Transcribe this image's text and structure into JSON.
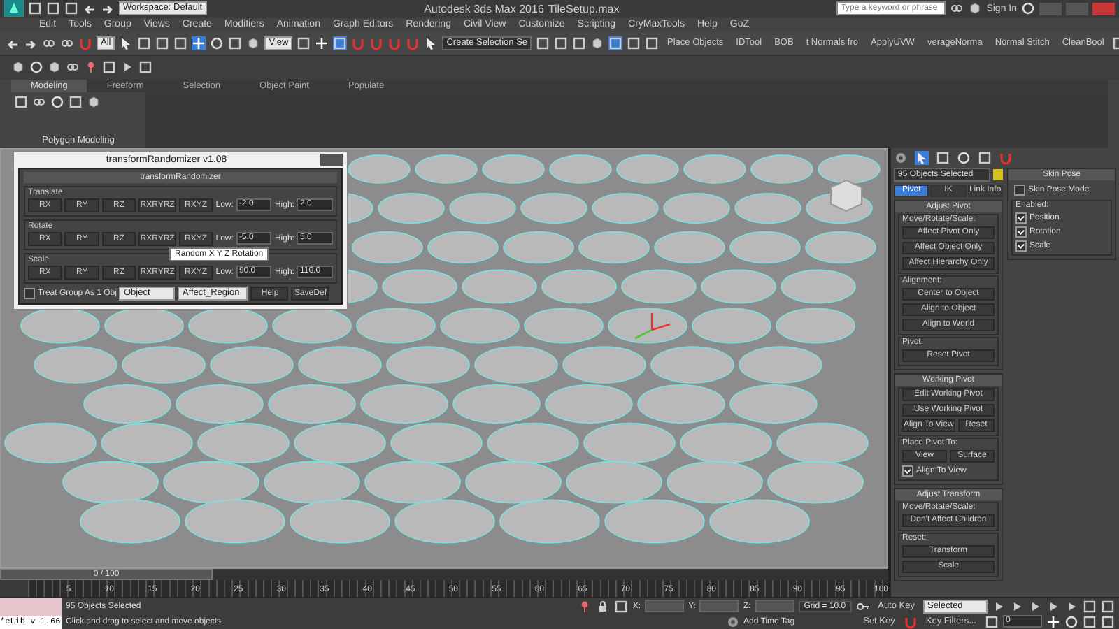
{
  "title_bar": {
    "workspace": "Workspace: Default",
    "app_title": "Autodesk 3ds Max 2016",
    "file_name": "TileSetup.max",
    "search": {
      "placeholder": "Type a keyword or phrase"
    },
    "sign_in": "Sign In"
  },
  "menu": [
    "Edit",
    "Tools",
    "Group",
    "Views",
    "Create",
    "Modifiers",
    "Animation",
    "Graph Editors",
    "Rendering",
    "Civil View",
    "Customize",
    "Scripting",
    "CryMaxTools",
    "Help",
    "GoZ"
  ],
  "main_toolbar": {
    "selection_filter": "All",
    "reference_coord": "View",
    "named_selection": "Create Selection Se",
    "script_buttons": [
      "Place Objects",
      "IDTool",
      "BOB",
      "t Normals fro",
      "ApplyUVW",
      "verageNorma",
      "Normal Stitch",
      "CleanBool"
    ]
  },
  "ribbon": {
    "tabs": [
      {
        "label": "Modeling",
        "selected": true
      },
      {
        "label": "Freeform",
        "selected": false
      },
      {
        "label": "Selection",
        "selected": false
      },
      {
        "label": "Object Paint",
        "selected": false
      },
      {
        "label": "Populate",
        "selected": false
      }
    ],
    "panel_label": "Polygon Modeling"
  },
  "dialog": {
    "title": "transformRandomizer v1.08",
    "rollout": "transformRandomizer",
    "groups": [
      {
        "label": "Translate",
        "buttons": [
          "RX",
          "RY",
          "RZ",
          "RXRYRZ",
          "RXYZ"
        ],
        "low_label": "Low:",
        "low": "-2.0",
        "high_label": "High:",
        "high": "2.0"
      },
      {
        "label": "Rotate",
        "buttons": [
          "RX",
          "RY",
          "RZ",
          "RXRYRZ",
          "RXYZ"
        ],
        "low_label": "Low:",
        "low": "-5.0",
        "high_label": "High:",
        "high": "5.0"
      },
      {
        "label": "Scale",
        "buttons": [
          "RX",
          "RY",
          "RZ",
          "RXRYRZ",
          "RXYZ"
        ],
        "low_label": "Low:",
        "low": "90.0",
        "high_label": "High:",
        "high": "110.0"
      }
    ],
    "treat_group": {
      "label": "Treat Group As 1 Obj",
      "checked": false
    },
    "mode": "Object",
    "region": "Affect_Region",
    "buttons": [
      "Help",
      "SaveDef"
    ],
    "tooltip": "Random X Y Z Rotation"
  },
  "command_panel": {
    "selection": "95 Objects Selected",
    "subtabs": [
      {
        "label": "Pivot",
        "selected": true
      },
      {
        "label": "IK",
        "selected": false
      },
      {
        "label": "Link Info",
        "selected": false
      }
    ],
    "rollouts": [
      {
        "title": "Adjust Pivot",
        "groups": [
          {
            "label": "Move/Rotate/Scale:",
            "items": [
              {
                "kind": "button",
                "labels": [
                  "Affect Pivot Only"
                ]
              },
              {
                "kind": "button",
                "labels": [
                  "Affect Object Only"
                ]
              },
              {
                "kind": "button",
                "labels": [
                  "Affect Hierarchy Only"
                ]
              }
            ]
          },
          {
            "label": "Alignment:",
            "items": [
              {
                "kind": "button",
                "labels": [
                  "Center to Object"
                ]
              },
              {
                "kind": "button",
                "labels": [
                  "Align to Object"
                ]
              },
              {
                "kind": "button",
                "labels": [
                  "Align to World"
                ]
              }
            ]
          },
          {
            "label": "Pivot:",
            "items": [
              {
                "kind": "button",
                "labels": [
                  "Reset Pivot"
                ]
              }
            ]
          }
        ]
      },
      {
        "title": "Working Pivot",
        "groups": [
          {
            "items": [
              {
                "kind": "button",
                "labels": [
                  "Edit Working Pivot"
                ]
              },
              {
                "kind": "button",
                "labels": [
                  "Use Working Pivot"
                ]
              },
              {
                "kind": "button",
                "labels": [
                  "Align To View",
                  "Reset"
                ]
              }
            ]
          },
          {
            "label": "Place Pivot To:",
            "items": [
              {
                "kind": "button",
                "labels": [
                  "View",
                  "Surface"
                ]
              },
              {
                "kind": "checkbox",
                "label": "Align To View",
                "checked": true
              }
            ]
          }
        ]
      },
      {
        "title": "Adjust Transform",
        "groups": [
          {
            "label": "Move/Rotate/Scale:",
            "items": [
              {
                "kind": "button",
                "labels": [
                  "Don't Affect Children"
                ]
              }
            ]
          },
          {
            "label": "Reset:",
            "items": [
              {
                "kind": "button",
                "labels": [
                  "Transform"
                ]
              },
              {
                "kind": "button",
                "labels": [
                  "Scale"
                ]
              }
            ]
          }
        ]
      }
    ]
  },
  "skin_pose": {
    "title": "Skin Pose",
    "mode": {
      "label": "Skin Pose Mode",
      "checked": false
    },
    "enabled_label": "Enabled:",
    "options": [
      {
        "label": "Position",
        "checked": true
      },
      {
        "label": "Rotation",
        "checked": true
      },
      {
        "label": "Scale",
        "checked": true
      }
    ]
  },
  "timeline": {
    "frame": "0 / 100",
    "level": 0,
    "ruler": [
      "5",
      "10",
      "15",
      "20",
      "25",
      "30",
      "35",
      "40",
      "45",
      "50",
      "55",
      "60",
      "65",
      "70",
      "75",
      "80",
      "85",
      "90",
      "95",
      "100"
    ]
  },
  "status": {
    "listener": "*eLib v 1.66",
    "selection": "95 Objects Selected",
    "x_label": "X:",
    "y_label": "Y:",
    "z_label": "Z:",
    "grid": "Grid = 10.0",
    "prompt": "Click and drag to select and move objects",
    "add_time_tag": "Add Time Tag"
  },
  "anim_controls": {
    "auto_key": "Auto Key",
    "key_mode": "Selected",
    "set_key": "Set Key",
    "key_filters": "Key Filters...",
    "frame": "0"
  }
}
